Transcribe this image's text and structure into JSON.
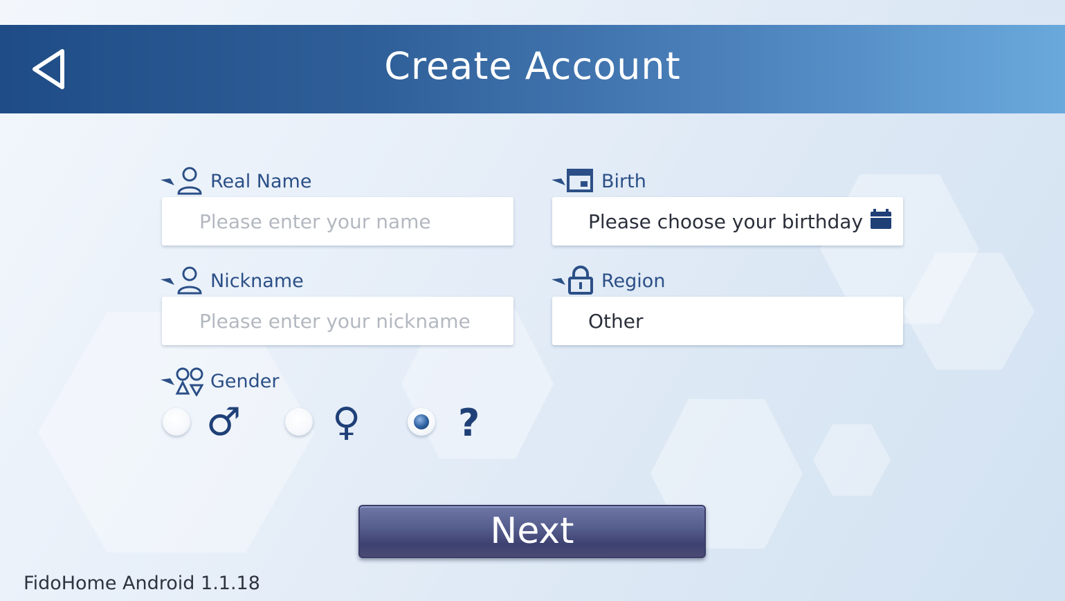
{
  "header": {
    "title": "Create Account",
    "back_icon": "back-triangle-icon"
  },
  "form": {
    "real_name": {
      "label": "Real Name",
      "placeholder": "Please enter your name",
      "value": "",
      "icon": "person-icon"
    },
    "nickname": {
      "label": "Nickname",
      "placeholder": "Please enter your nickname",
      "value": "",
      "icon": "person-icon"
    },
    "birth": {
      "label": "Birth",
      "value": "Please choose your birthday",
      "icon": "calendar-card-icon",
      "picker_icon": "calendar-icon"
    },
    "region": {
      "label": "Region",
      "value": "Other",
      "icon": "lock-icon"
    },
    "gender": {
      "label": "Gender",
      "icon": "gender-symbols-icon",
      "options": [
        {
          "symbol": "♂",
          "icon": "male-icon",
          "selected": false
        },
        {
          "symbol": "♀",
          "icon": "female-icon",
          "selected": false
        },
        {
          "symbol": "?",
          "icon": "question-icon",
          "selected": true
        }
      ]
    }
  },
  "next_button": {
    "label": "Next"
  },
  "footer": {
    "version": "FidoHome Android 1.1.18"
  },
  "colors": {
    "header_start": "#1f4c86",
    "header_end": "#6aa9dc",
    "label": "#2b4f86",
    "button": "#545c8c"
  }
}
